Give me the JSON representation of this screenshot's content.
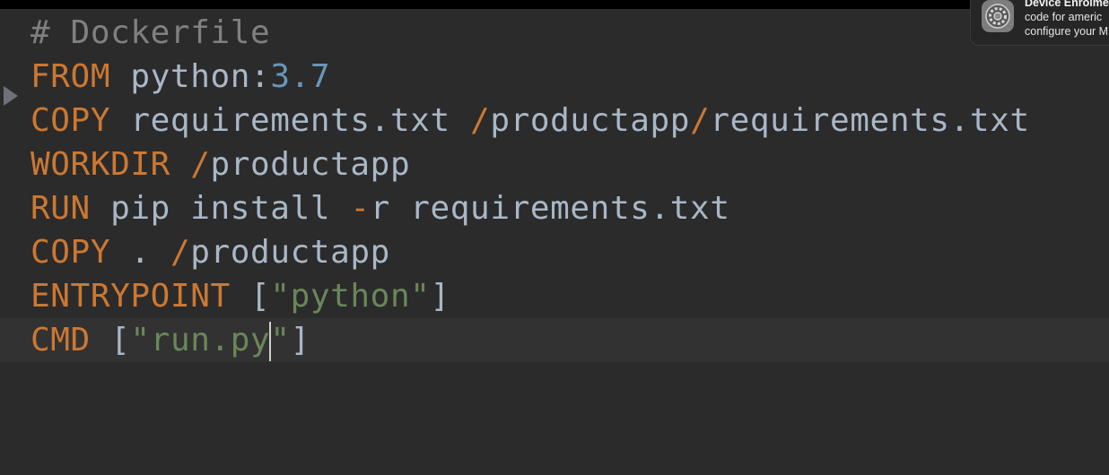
{
  "editor": {
    "lines": [
      {
        "tokens": [
          {
            "t": "comment",
            "v": "# Dockerfile"
          }
        ]
      },
      {
        "tokens": [
          {
            "t": "kw",
            "v": "FROM"
          },
          {
            "t": "txt",
            "v": " python:"
          },
          {
            "t": "num",
            "v": "3.7"
          }
        ]
      },
      {
        "tokens": [
          {
            "t": "kw",
            "v": "COPY"
          },
          {
            "t": "txt",
            "v": " requirements.txt "
          },
          {
            "t": "kw",
            "v": "/"
          },
          {
            "t": "txt",
            "v": "productapp"
          },
          {
            "t": "kw",
            "v": "/"
          },
          {
            "t": "txt",
            "v": "requirements.txt"
          }
        ]
      },
      {
        "tokens": [
          {
            "t": "kw",
            "v": "WORKDIR"
          },
          {
            "t": "txt",
            "v": " "
          },
          {
            "t": "kw",
            "v": "/"
          },
          {
            "t": "txt",
            "v": "productapp"
          }
        ]
      },
      {
        "tokens": [
          {
            "t": "kw",
            "v": "RUN"
          },
          {
            "t": "txt",
            "v": " pip install "
          },
          {
            "t": "kw",
            "v": "-"
          },
          {
            "t": "txt",
            "v": "r requirements.txt"
          }
        ]
      },
      {
        "tokens": [
          {
            "t": "kw",
            "v": "COPY"
          },
          {
            "t": "txt",
            "v": " . "
          },
          {
            "t": "kw",
            "v": "/"
          },
          {
            "t": "txt",
            "v": "productapp"
          }
        ]
      },
      {
        "tokens": [
          {
            "t": "kw",
            "v": "ENTRYPOINT"
          },
          {
            "t": "txt",
            "v": " ["
          },
          {
            "t": "str",
            "v": "\"python\""
          },
          {
            "t": "txt",
            "v": "]"
          }
        ]
      },
      {
        "tokens": [
          {
            "t": "kw",
            "v": "CMD"
          },
          {
            "t": "txt",
            "v": " ["
          },
          {
            "t": "str",
            "v": "\"run.py"
          },
          {
            "t": "caret",
            "v": ""
          },
          {
            "t": "str",
            "v": "\""
          },
          {
            "t": "txt",
            "v": "]"
          }
        ],
        "current": true
      }
    ]
  },
  "notification": {
    "icon": "system-preferences-gear-icon",
    "title": "Device Enrolment",
    "line1": "code for americ",
    "line2": "configure your M"
  },
  "colors": {
    "background": "#2b2b2b",
    "current_line": "#323232",
    "keyword": "#cc7832",
    "text": "#a9b7c6",
    "number": "#6897bb",
    "string": "#6a8759",
    "comment": "#808080"
  }
}
